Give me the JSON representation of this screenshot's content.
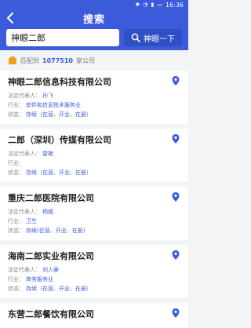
{
  "status": {
    "time": "16:36",
    "icons": [
      "bluetooth-icon",
      "wifi-icon",
      "signal-icon",
      "battery-icon"
    ]
  },
  "header": {
    "title": "搜索"
  },
  "search": {
    "value": "神眼二郎",
    "button_label": "神眼一下"
  },
  "stats": {
    "prefix": "匹配到",
    "count": "1077510",
    "suffix": "家公司"
  },
  "labels": {
    "rep": "法定代表人：",
    "industry": "行业：",
    "status": "状态："
  },
  "results": [
    {
      "name": "神眼二郎信息科技有限公司",
      "rep": "孙飞",
      "industry": "软件和信息技术服务业",
      "status": "存续（在营、开业、在册）"
    },
    {
      "name": "二郎（深圳）传媒有限公司",
      "rep": "雷艳",
      "industry": "",
      "status": "存续（在营、开业、在册）"
    },
    {
      "name": "重庆二郎医院有限公司",
      "rep": "杨威",
      "industry": "卫生",
      "status": "存续(在营、开业、在册)"
    },
    {
      "name": "海南二郎实业有限公司",
      "rep": "刘人豪",
      "industry": "商务服务业",
      "status": "存续（在营、开业、在册）"
    },
    {
      "name": "东营二郎餐饮有限公司"
    }
  ],
  "colors": {
    "primary": "#3b5bdb",
    "accent_text": "#3b5bdb"
  }
}
